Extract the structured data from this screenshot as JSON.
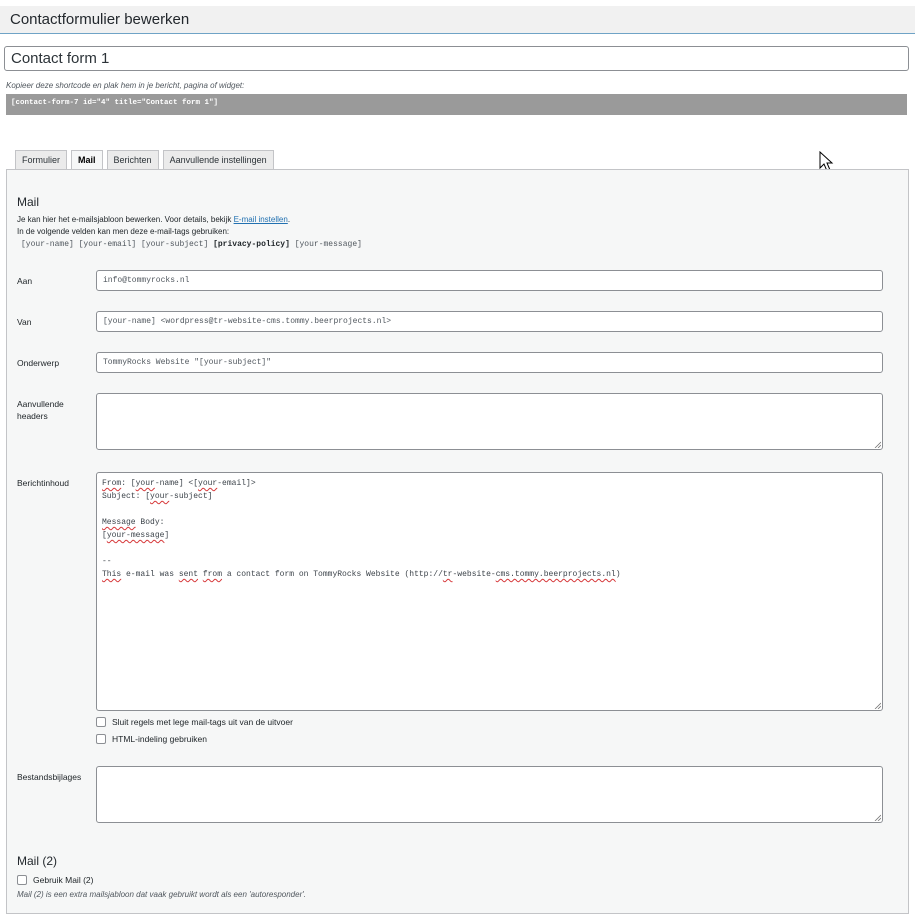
{
  "header": {
    "title": "Contactformulier bewerken"
  },
  "form_title": {
    "value": "Contact form 1"
  },
  "shortcode": {
    "hint": "Kopieer deze shortcode en plak hem in je bericht, pagina of widget:",
    "code": "[contact-form-7 id=\"4\" title=\"Contact form 1\"]"
  },
  "tabs": [
    {
      "label": "Formulier",
      "active": false
    },
    {
      "label": "Mail",
      "active": true
    },
    {
      "label": "Berichten",
      "active": false
    },
    {
      "label": "Aanvullende instellingen",
      "active": false
    }
  ],
  "mail": {
    "section_title": "Mail",
    "desc_prefix": "Je kan hier het e-mailsjabloon bewerken. Voor details, bekijk ",
    "desc_link": "E-mail instellen",
    "desc_suffix": ".",
    "desc_line2": "In de volgende velden kan men deze e-mail-tags gebruiken:",
    "tags": [
      "[your-name]",
      "[your-email]",
      "[your-subject]",
      "[privacy-policy]",
      "[your-message]"
    ],
    "fields": {
      "to": {
        "label": "Aan",
        "value": "info@tommyrocks.nl"
      },
      "from": {
        "label": "Van",
        "value": "[your-name] <wordpress@tr-website-cms.tommy.beerprojects.nl>"
      },
      "subject": {
        "label": "Onderwerp",
        "value": "TommyRocks Website \"[your-subject]\""
      },
      "headers": {
        "label_line1": "Aanvullende",
        "label_line2": "headers",
        "value": ""
      },
      "body": {
        "label": "Berichtinhoud"
      },
      "attachments": {
        "label": "Bestandsbijlages",
        "value": ""
      }
    },
    "body_lines": {
      "l1": {
        "a": "From",
        "b": ": [",
        "c": "your",
        "d": "-name] <[",
        "e": "your",
        "f": "-email]>"
      },
      "l2": {
        "a": "Subject: [",
        "b": "your",
        "c": "-subject]"
      },
      "l4": {
        "a": "Message",
        "b": " Body:"
      },
      "l5": {
        "a": "[",
        "b": "your-message",
        "c": "]"
      },
      "l7": "--",
      "l8": {
        "a": "This",
        "b": " e-mail was ",
        "c": "sent",
        "d": " ",
        "e": "from",
        "f": " a contact form on TommyRocks Website (http://",
        "g": "tr",
        "h": "-website-",
        "i": "cms.tommy.beerprojects.nl",
        "j": ")"
      }
    },
    "checkboxes": {
      "exclude_blank": "Sluit regels met lege mail-tags uit van de uitvoer",
      "use_html": "HTML-indeling gebruiken"
    }
  },
  "mail2": {
    "section_title": "Mail (2)",
    "checkbox_label": "Gebruik Mail (2)",
    "note": "Mail (2) is een extra mailsjabloon dat vaak gebruikt wordt als een 'autoresponder'."
  }
}
